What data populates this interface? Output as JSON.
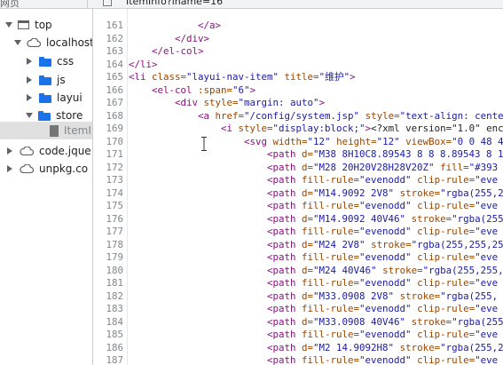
{
  "topbar": {
    "tab_label": "网页",
    "file_tab": "ItemInfo?iname=16"
  },
  "sidebar": {
    "items": [
      {
        "label": "top",
        "icon": "frame-icon",
        "expanded": true
      },
      {
        "label": "localhost:",
        "icon": "cloud-icon",
        "expanded": true
      },
      {
        "label": "css",
        "icon": "folder-icon"
      },
      {
        "label": "js",
        "icon": "folder-icon"
      },
      {
        "label": "layui",
        "icon": "folder-icon"
      },
      {
        "label": "store",
        "icon": "folder-icon",
        "expanded": true
      },
      {
        "label": "ItemI",
        "icon": "file-icon",
        "selected": true
      },
      {
        "label": "code.jque",
        "icon": "cloud-icon"
      },
      {
        "label": "unpkg.co",
        "icon": "cloud-icon"
      }
    ]
  },
  "editor": {
    "lines": [
      {
        "n": "161",
        "indent": "            ",
        "parts": [
          [
            "tag",
            "</a>"
          ]
        ]
      },
      {
        "n": "162",
        "indent": "        ",
        "parts": [
          [
            "tag",
            "</div>"
          ]
        ]
      },
      {
        "n": "163",
        "indent": "    ",
        "parts": [
          [
            "tag",
            "</el-col>"
          ]
        ]
      },
      {
        "n": "164",
        "indent": "",
        "parts": [
          [
            "tag",
            "</li>"
          ]
        ]
      },
      {
        "n": "165",
        "indent": "",
        "parts": [
          [
            "tag",
            "<li "
          ],
          [
            "attr",
            "class="
          ],
          [
            "val",
            "\"layui-nav-item\""
          ],
          [
            "attr",
            " title="
          ],
          [
            "val",
            "\"维护\""
          ],
          [
            "tag",
            ">"
          ]
        ]
      },
      {
        "n": "166",
        "indent": "    ",
        "parts": [
          [
            "tag",
            "<el-col "
          ],
          [
            "attr",
            ":span="
          ],
          [
            "val",
            "\"6\""
          ],
          [
            "tag",
            ">"
          ]
        ]
      },
      {
        "n": "167",
        "indent": "        ",
        "parts": [
          [
            "tag",
            "<div "
          ],
          [
            "attr",
            "style="
          ],
          [
            "val",
            "\"margin: auto\""
          ],
          [
            "tag",
            ">"
          ]
        ]
      },
      {
        "n": "168",
        "indent": "            ",
        "parts": [
          [
            "tag",
            "<a "
          ],
          [
            "attr",
            "href="
          ],
          [
            "val",
            "\"/config/system.jsp\""
          ],
          [
            "attr",
            " style="
          ],
          [
            "val",
            "\"text-align: cente"
          ]
        ]
      },
      {
        "n": "169",
        "indent": "                ",
        "parts": [
          [
            "tag",
            "<i "
          ],
          [
            "attr",
            "style="
          ],
          [
            "val",
            "\"display:block;\""
          ],
          [
            "tag",
            ">"
          ],
          [
            "txt",
            "<?xml version=\"1.0\" enc"
          ]
        ]
      },
      {
        "n": "170",
        "indent": "                    ",
        "parts": [
          [
            "tag",
            "<svg "
          ],
          [
            "attr",
            "width="
          ],
          [
            "val",
            "\"12\""
          ],
          [
            "attr",
            " height="
          ],
          [
            "val",
            "\"12\""
          ],
          [
            "attr",
            " viewBox="
          ],
          [
            "val",
            "\"0 0 48 4"
          ]
        ]
      },
      {
        "n": "171",
        "indent": "                        ",
        "parts": [
          [
            "tag",
            "<path "
          ],
          [
            "attr",
            "d="
          ],
          [
            "val",
            "\"M38 8H10C8.89543 8 8 8.89543 8 1"
          ]
        ]
      },
      {
        "n": "172",
        "indent": "                        ",
        "parts": [
          [
            "tag",
            "<path "
          ],
          [
            "attr",
            "d="
          ],
          [
            "val",
            "\"M28 20H20V28H28V20Z\""
          ],
          [
            "attr",
            " fill="
          ],
          [
            "val",
            "\"#393"
          ]
        ]
      },
      {
        "n": "173",
        "indent": "                        ",
        "parts": [
          [
            "tag",
            "<path "
          ],
          [
            "attr",
            "fill-rule="
          ],
          [
            "val",
            "\"evenodd\""
          ],
          [
            "attr",
            " clip-rule="
          ],
          [
            "val",
            "\"eve"
          ]
        ]
      },
      {
        "n": "174",
        "indent": "                        ",
        "parts": [
          [
            "tag",
            "<path "
          ],
          [
            "attr",
            "d="
          ],
          [
            "val",
            "\"M14.9092 2V8\""
          ],
          [
            "attr",
            " stroke="
          ],
          [
            "val",
            "\"rgba(255,2"
          ]
        ]
      },
      {
        "n": "175",
        "indent": "                        ",
        "parts": [
          [
            "tag",
            "<path "
          ],
          [
            "attr",
            "fill-rule="
          ],
          [
            "val",
            "\"evenodd\""
          ],
          [
            "attr",
            " clip-rule="
          ],
          [
            "val",
            "\"eve"
          ]
        ]
      },
      {
        "n": "176",
        "indent": "                        ",
        "parts": [
          [
            "tag",
            "<path "
          ],
          [
            "attr",
            "d="
          ],
          [
            "val",
            "\"M14.9092 40V46\""
          ],
          [
            "attr",
            " stroke="
          ],
          [
            "val",
            "\"rgba(255"
          ]
        ]
      },
      {
        "n": "177",
        "indent": "                        ",
        "parts": [
          [
            "tag",
            "<path "
          ],
          [
            "attr",
            "fill-rule="
          ],
          [
            "val",
            "\"evenodd\""
          ],
          [
            "attr",
            " clip-rule="
          ],
          [
            "val",
            "\"eve"
          ]
        ]
      },
      {
        "n": "178",
        "indent": "                        ",
        "parts": [
          [
            "tag",
            "<path "
          ],
          [
            "attr",
            "d="
          ],
          [
            "val",
            "\"M24 2V8\""
          ],
          [
            "attr",
            " stroke="
          ],
          [
            "val",
            "\"rgba(255,255,25"
          ]
        ]
      },
      {
        "n": "179",
        "indent": "                        ",
        "parts": [
          [
            "tag",
            "<path "
          ],
          [
            "attr",
            "fill-rule="
          ],
          [
            "val",
            "\"evenodd\""
          ],
          [
            "attr",
            " clip-rule="
          ],
          [
            "val",
            "\"eve"
          ]
        ]
      },
      {
        "n": "180",
        "indent": "                        ",
        "parts": [
          [
            "tag",
            "<path "
          ],
          [
            "attr",
            "d="
          ],
          [
            "val",
            "\"M24 40V46\""
          ],
          [
            "attr",
            " stroke="
          ],
          [
            "val",
            "\"rgba(255,255,"
          ]
        ]
      },
      {
        "n": "181",
        "indent": "                        ",
        "parts": [
          [
            "tag",
            "<path "
          ],
          [
            "attr",
            "fill-rule="
          ],
          [
            "val",
            "\"evenodd\""
          ],
          [
            "attr",
            " clip-rule="
          ],
          [
            "val",
            "\"eve"
          ]
        ]
      },
      {
        "n": "182",
        "indent": "                        ",
        "parts": [
          [
            "tag",
            "<path "
          ],
          [
            "attr",
            "d="
          ],
          [
            "val",
            "\"M33.0908 2V8\""
          ],
          [
            "attr",
            " stroke="
          ],
          [
            "val",
            "\"rgba(255,"
          ]
        ]
      },
      {
        "n": "183",
        "indent": "                        ",
        "parts": [
          [
            "tag",
            "<path "
          ],
          [
            "attr",
            "fill-rule="
          ],
          [
            "val",
            "\"evenodd\""
          ],
          [
            "attr",
            " clip-rule="
          ],
          [
            "val",
            "\"eve"
          ]
        ]
      },
      {
        "n": "184",
        "indent": "                        ",
        "parts": [
          [
            "tag",
            "<path "
          ],
          [
            "attr",
            "d="
          ],
          [
            "val",
            "\"M33.0908 40V46\""
          ],
          [
            "attr",
            " stroke="
          ],
          [
            "val",
            "\"rgba(255"
          ]
        ]
      },
      {
        "n": "185",
        "indent": "                        ",
        "parts": [
          [
            "tag",
            "<path "
          ],
          [
            "attr",
            "fill-rule="
          ],
          [
            "val",
            "\"evenodd\""
          ],
          [
            "attr",
            " clip-rule="
          ],
          [
            "val",
            "\"eve"
          ]
        ]
      },
      {
        "n": "186",
        "indent": "                        ",
        "parts": [
          [
            "tag",
            "<path "
          ],
          [
            "attr",
            "d="
          ],
          [
            "val",
            "\"M2 14.9092H8\""
          ],
          [
            "attr",
            " stroke="
          ],
          [
            "val",
            "\"rgba(255,2"
          ]
        ]
      },
      {
        "n": "187",
        "indent": "                        ",
        "parts": [
          [
            "tag",
            "<path "
          ],
          [
            "attr",
            "fill-rule="
          ],
          [
            "val",
            "\"evenodd\""
          ],
          [
            "attr",
            " clip-rule="
          ],
          [
            "val",
            "\"eve"
          ]
        ]
      }
    ]
  },
  "colors": {
    "tag": "#881280",
    "attr": "#994500",
    "value": "#1a1aa6",
    "folder": "#1a73e8"
  }
}
